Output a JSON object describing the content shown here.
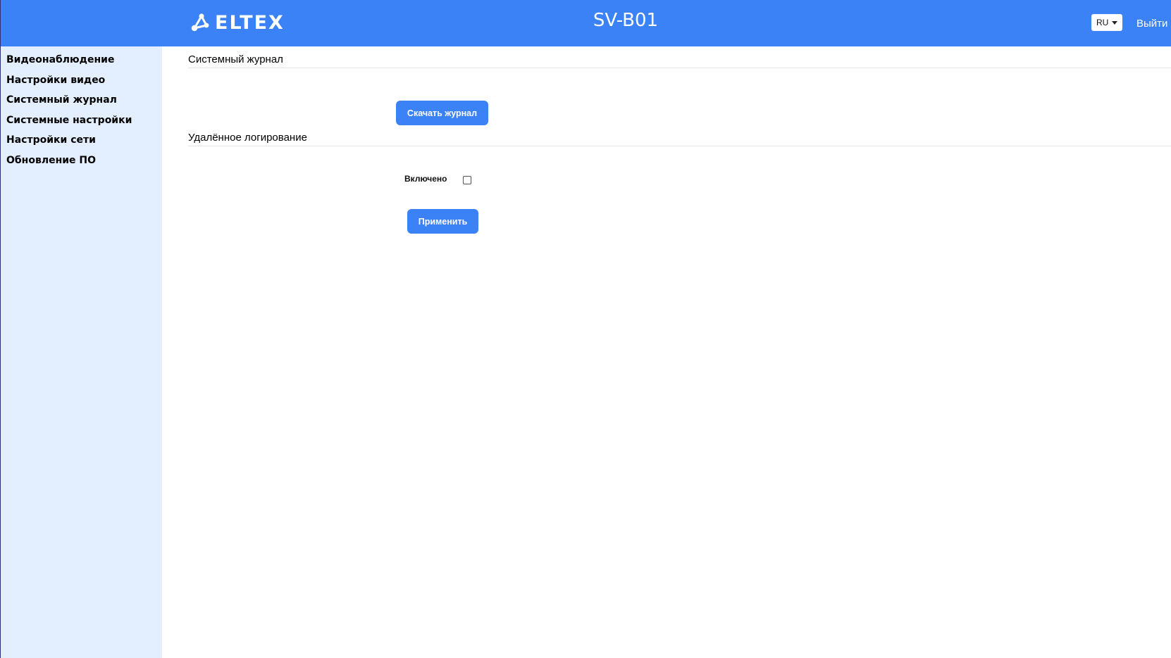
{
  "header": {
    "logo_text": "ELTEX",
    "device_title": "SV-B01",
    "language": "RU",
    "logout_label": "Выйти",
    "background_color": "#3b82f6"
  },
  "sidebar": {
    "items": [
      {
        "label": "Видеонаблюдение"
      },
      {
        "label": "Настройки видео"
      },
      {
        "label": "Системный журнал"
      },
      {
        "label": "Системные настройки"
      },
      {
        "label": "Настройки сети"
      },
      {
        "label": "Обновление ПО"
      }
    ],
    "background_color": "#e3efff"
  },
  "main": {
    "syslog": {
      "title": "Системный журнал",
      "download_label": "Скачать журнал"
    },
    "remote_logging": {
      "title": "Удалённое логирование",
      "enabled_label": "Включено",
      "enabled_checked": false,
      "apply_label": "Применить"
    },
    "accent_color": "#3b82f6"
  }
}
